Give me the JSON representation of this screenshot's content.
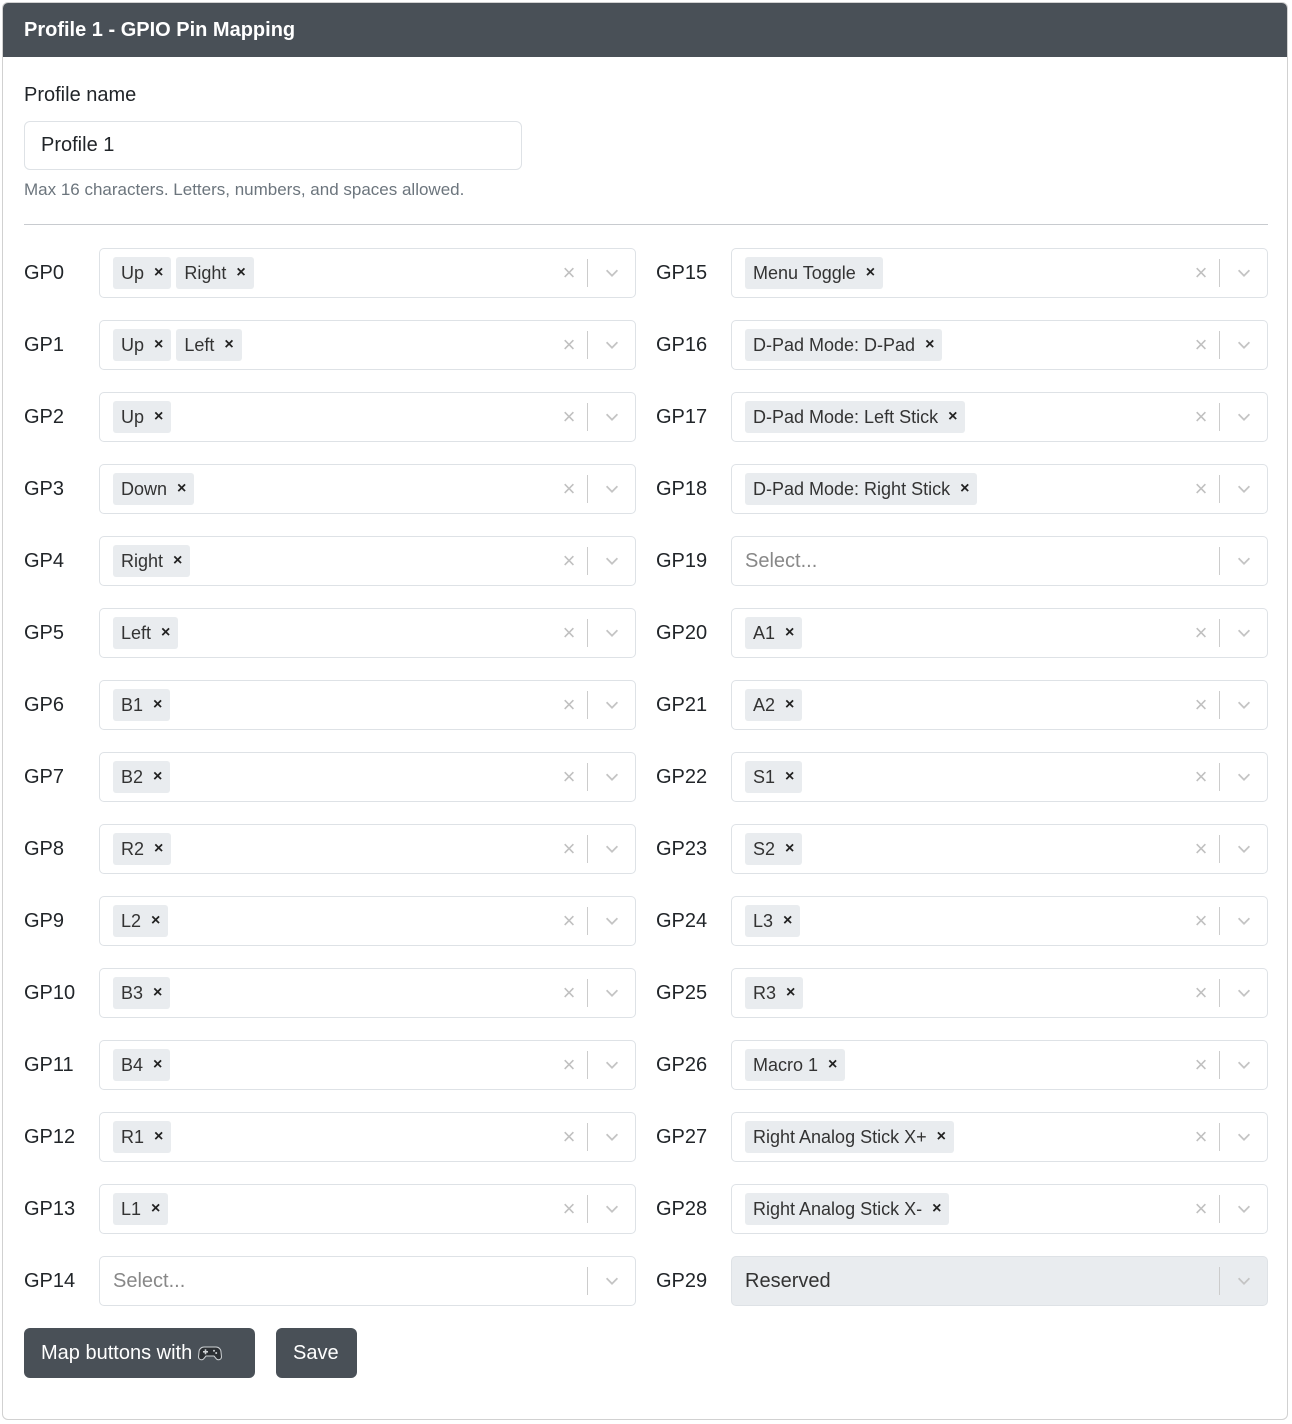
{
  "header": {
    "title": "Profile 1 - GPIO Pin Mapping"
  },
  "profile": {
    "label": "Profile name",
    "value": "Profile 1",
    "help": "Max 16 characters. Letters, numbers, and spaces allowed."
  },
  "pins": [
    {
      "label": "GP0",
      "values": [
        "Up",
        "Right"
      ]
    },
    {
      "label": "GP1",
      "values": [
        "Up",
        "Left"
      ]
    },
    {
      "label": "GP2",
      "values": [
        "Up"
      ]
    },
    {
      "label": "GP3",
      "values": [
        "Down"
      ]
    },
    {
      "label": "GP4",
      "values": [
        "Right"
      ]
    },
    {
      "label": "GP5",
      "values": [
        "Left"
      ]
    },
    {
      "label": "GP6",
      "values": [
        "B1"
      ]
    },
    {
      "label": "GP7",
      "values": [
        "B2"
      ]
    },
    {
      "label": "GP8",
      "values": [
        "R2"
      ]
    },
    {
      "label": "GP9",
      "values": [
        "L2"
      ]
    },
    {
      "label": "GP10",
      "values": [
        "B3"
      ]
    },
    {
      "label": "GP11",
      "values": [
        "B4"
      ]
    },
    {
      "label": "GP12",
      "values": [
        "R1"
      ]
    },
    {
      "label": "GP13",
      "values": [
        "L1"
      ]
    },
    {
      "label": "GP14",
      "values": [],
      "placeholder": "Select..."
    },
    {
      "label": "GP15",
      "values": [
        "Menu Toggle"
      ]
    },
    {
      "label": "GP16",
      "values": [
        "D-Pad Mode: D-Pad"
      ]
    },
    {
      "label": "GP17",
      "values": [
        "D-Pad Mode: Left Stick"
      ]
    },
    {
      "label": "GP18",
      "values": [
        "D-Pad Mode: Right Stick"
      ]
    },
    {
      "label": "GP19",
      "values": [],
      "placeholder": "Select..."
    },
    {
      "label": "GP20",
      "values": [
        "A1"
      ]
    },
    {
      "label": "GP21",
      "values": [
        "A2"
      ]
    },
    {
      "label": "GP22",
      "values": [
        "S1"
      ]
    },
    {
      "label": "GP23",
      "values": [
        "S2"
      ]
    },
    {
      "label": "GP24",
      "values": [
        "L3"
      ]
    },
    {
      "label": "GP25",
      "values": [
        "R3"
      ]
    },
    {
      "label": "GP26",
      "values": [
        "Macro 1"
      ]
    },
    {
      "label": "GP27",
      "values": [
        "Right Analog Stick X+"
      ]
    },
    {
      "label": "GP28",
      "values": [
        "Right Analog Stick X-"
      ]
    },
    {
      "label": "GP29",
      "values": [],
      "single": "Reserved",
      "disabled": true
    }
  ],
  "icons": {
    "chip_remove": "×",
    "clear": "×",
    "dropdown": "chevron-down-icon",
    "gamepad": "gamepad-icon"
  },
  "buttons": {
    "map": "Map buttons with",
    "save": "Save"
  }
}
